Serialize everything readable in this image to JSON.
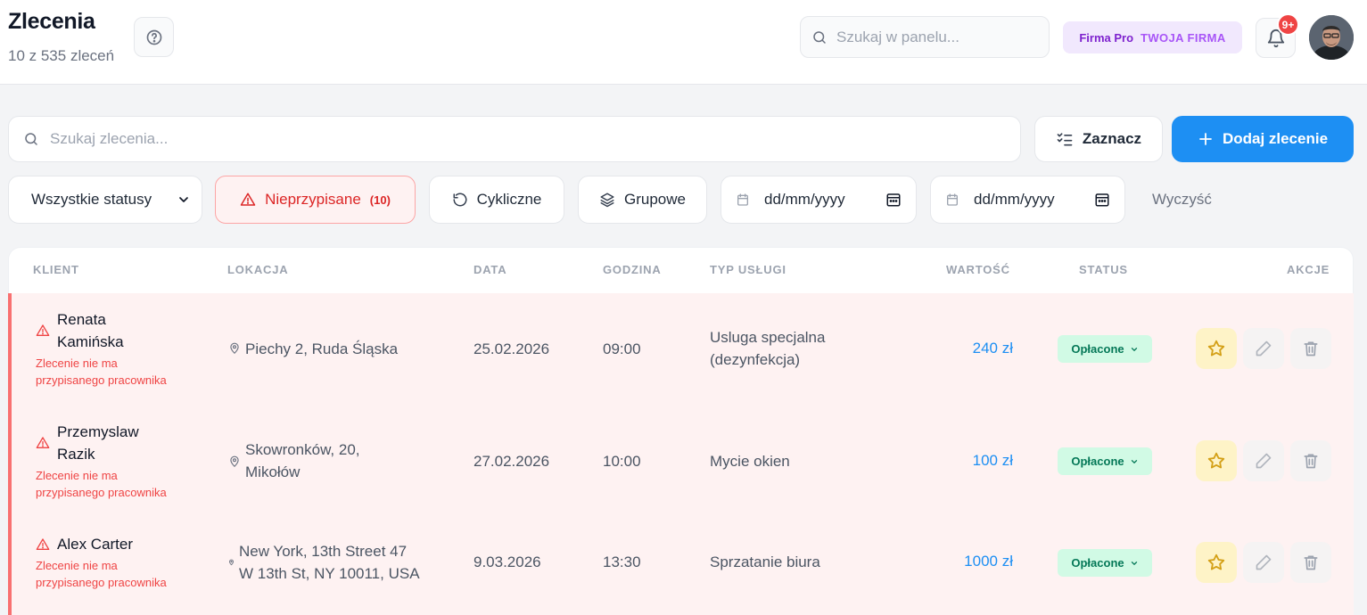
{
  "header": {
    "title": "Zlecenia",
    "subtitle": "10 z 535 zleceń",
    "search_placeholder": "Szukaj w panelu...",
    "plan": "Firma Pro",
    "company": "TWOJA FIRMA",
    "notifications_badge": "9+"
  },
  "toolbar": {
    "search_placeholder": "Szukaj zlecenia...",
    "select_label": "Zaznacz",
    "add_label": "Dodaj zlecenie"
  },
  "filters": {
    "status_selected": "Wszystkie statusy",
    "unassigned_label": "Nieprzypisane",
    "unassigned_count": "(10)",
    "cyclic_label": "Cykliczne",
    "group_label": "Grupowe",
    "date_from_placeholder": "dd/mm/yyyy",
    "date_to_placeholder": "dd/mm/yyyy",
    "clear_label": "Wyczyść"
  },
  "table": {
    "headers": {
      "client": "KLIENT",
      "location": "LOKACJA",
      "date": "DATA",
      "time": "GODZINA",
      "service": "TYP USŁUGI",
      "value": "WARTOŚĆ",
      "status": "STATUS",
      "actions": "AKCJE"
    },
    "rows": [
      {
        "client_line1": "Renata",
        "client_line2": "Kamińska",
        "warning_line1": "Zlecenie nie ma",
        "warning_line2": "przypisanego pracownika",
        "location_line1": "Piechy 2, Ruda Śląska",
        "location_line2": "",
        "date": "25.02.2026",
        "time": "09:00",
        "service_line1": "Usluga specjalna",
        "service_line2": "(dezynfekcja)",
        "value": "240 zł",
        "status": "Opłacone"
      },
      {
        "client_line1": "Przemyslaw",
        "client_line2": "Razik",
        "warning_line1": "Zlecenie nie ma",
        "warning_line2": "przypisanego pracownika",
        "location_line1": "Skowronków, 20,",
        "location_line2": "Mikołów",
        "date": "27.02.2026",
        "time": "10:00",
        "service_line1": "Mycie okien",
        "service_line2": "",
        "value": "100 zł",
        "status": "Opłacone"
      },
      {
        "client_line1": "Alex Carter",
        "client_line2": "",
        "warning_line1": "Zlecenie nie ma",
        "warning_line2": "przypisanego pracownika",
        "location_line1": "New York, 13th Street 47",
        "location_line2": "W 13th St, NY 10011, USA",
        "date": "9.03.2026",
        "time": "13:30",
        "service_line1": "Sprzatanie biura",
        "service_line2": "",
        "value": "1000 zł",
        "status": "Opłacone"
      }
    ]
  },
  "colors": {
    "accent": "#1d8ff3",
    "danger": "#ef4444",
    "paid_bg": "#d1fae5",
    "paid_text": "#047857",
    "row_bg": "#fef2f2"
  }
}
